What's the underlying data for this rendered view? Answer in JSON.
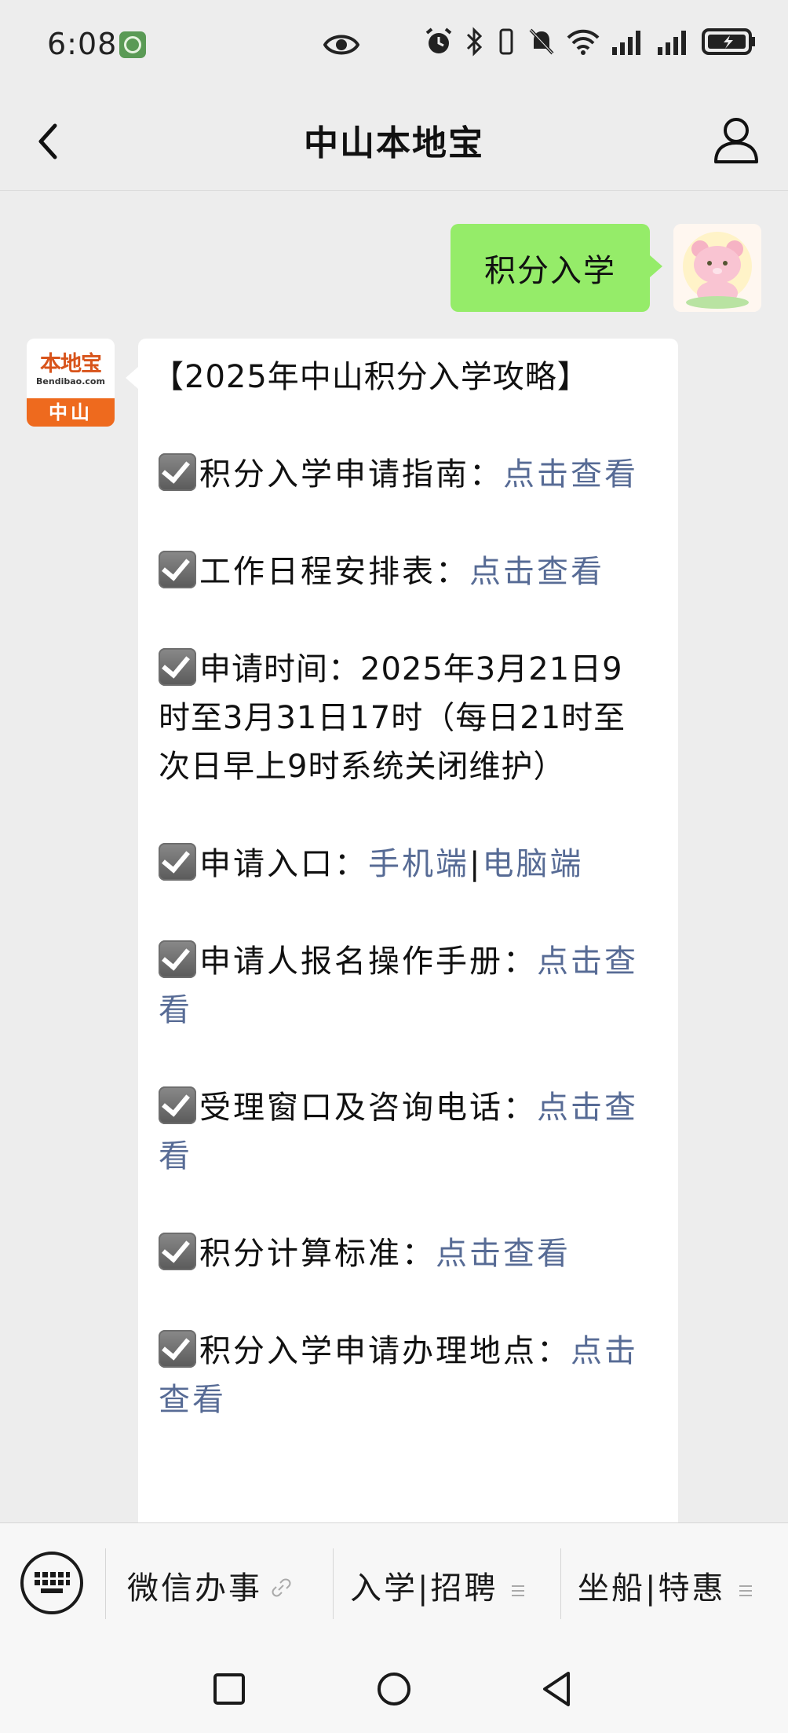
{
  "status_bar": {
    "time": "6:08"
  },
  "header": {
    "title": "中山本地宝"
  },
  "chat": {
    "sent_message": "积分入学",
    "bot_logo": {
      "name": "本地宝",
      "domain": "Bendibao.com",
      "city": "中山"
    },
    "reply": {
      "title": "【2025年中山积分入学攻略】",
      "items": [
        {
          "label": "积分入学申请指南：",
          "link": "点击查看"
        },
        {
          "label": "工作日程安排表：",
          "link": "点击查看"
        },
        {
          "label": "申请时间：2025年3月21日9时至3月31日17时（每日21时至次日早上9时系统关闭维护）"
        },
        {
          "label": "申请入口：",
          "link": "手机端",
          "separator": "|",
          "link2": "电脑端"
        },
        {
          "label": "申请人报名操作手册：",
          "link": "点击查看"
        },
        {
          "label": "受理窗口及咨询电话：",
          "link": "点击查看"
        },
        {
          "label": "积分计算标准：",
          "link": "点击查看"
        },
        {
          "label": "积分入学申请办理地点：",
          "link": "点击查看"
        }
      ]
    }
  },
  "menu": {
    "items": [
      {
        "label": "微信办事",
        "icon": "link-icon"
      },
      {
        "label": "入学|招聘",
        "icon": "menu-lines-icon"
      },
      {
        "label": "坐船|特惠",
        "icon": "menu-lines-icon"
      }
    ]
  },
  "colors": {
    "sent_bubble": "#95ec69",
    "link": "#576b95",
    "background": "#ededed",
    "logo_orange": "#ee6a1e"
  }
}
